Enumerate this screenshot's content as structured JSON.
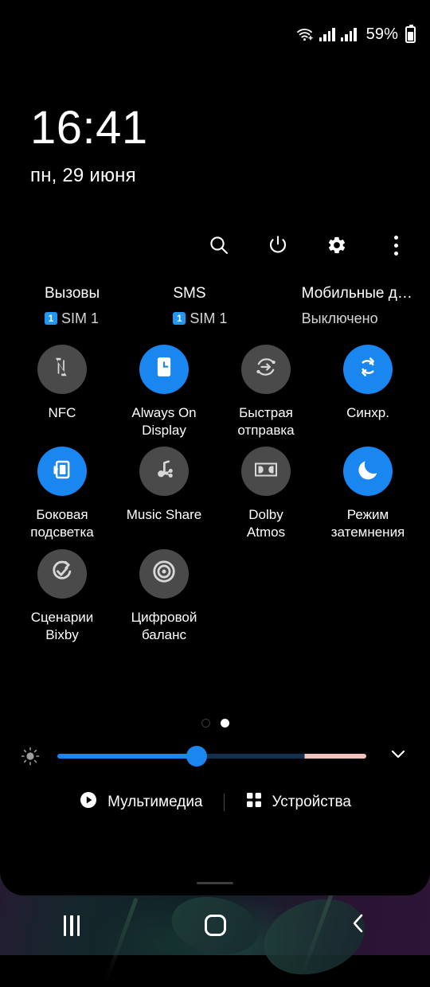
{
  "statusbar": {
    "wifi_icon": "wifi-calling-icon",
    "signal1_icon": "signal-bars-icon",
    "signal2_icon": "signal-bars-icon",
    "battery_percent": "59%",
    "battery_icon": "battery-icon"
  },
  "clock": {
    "time": "16:41",
    "date": "пн, 29 июня"
  },
  "toolbar": {
    "search_icon": "search-icon",
    "power_icon": "power-icon",
    "settings_icon": "gear-icon",
    "overflow_icon": "more-vertical-icon"
  },
  "sim_row": [
    {
      "title": "Вызовы",
      "badge": "1",
      "sub": "SIM 1",
      "has_badge": true
    },
    {
      "title": "SMS",
      "badge": "1",
      "sub": "SIM 1",
      "has_badge": true
    },
    {
      "title": "Мобильные да…",
      "badge": "",
      "sub": "Выключено",
      "has_badge": false
    }
  ],
  "tiles": [
    {
      "label": "NFC",
      "icon": "nfc-icon",
      "state": "off"
    },
    {
      "label": "Always On\nDisplay",
      "icon": "always-on-display-icon",
      "state": "on"
    },
    {
      "label": "Быстрая\nотправка",
      "icon": "quick-share-icon",
      "state": "off"
    },
    {
      "label": "Синхр.",
      "icon": "sync-icon",
      "state": "on"
    },
    {
      "label": "Боковая\nподсветка",
      "icon": "edge-lighting-icon",
      "state": "on"
    },
    {
      "label": "Music Share",
      "icon": "music-share-icon",
      "state": "off"
    },
    {
      "label": "Dolby\nAtmos",
      "icon": "dolby-atmos-icon",
      "state": "off"
    },
    {
      "label": "Режим\nзатемнения",
      "icon": "dark-mode-moon-icon",
      "state": "on"
    },
    {
      "label": "Сценарии\nBixby",
      "icon": "bixby-routines-icon",
      "state": "off"
    },
    {
      "label": "Цифровой\nбаланс",
      "icon": "digital-wellbeing-icon",
      "state": "off"
    }
  ],
  "pager": {
    "pages": 2,
    "active": 2
  },
  "brightness": {
    "icon": "brightness-icon",
    "value_percent": 45,
    "expand_icon": "chevron-down-icon"
  },
  "bottom_actions": [
    {
      "label": "Мультимедиа",
      "icon": "play-circle-icon"
    },
    {
      "label": "Устройства",
      "icon": "grid-dots-icon"
    }
  ],
  "navbar": {
    "recents_icon": "recents-icon",
    "home_icon": "home-icon",
    "back_icon": "back-chevron-icon"
  },
  "colors": {
    "accent_blue": "#1a86f0",
    "tile_off": "#4a4a4a",
    "badge_blue": "#2196f3",
    "slider_warm": "#f3c4bb",
    "panel_bg": "#000000"
  }
}
